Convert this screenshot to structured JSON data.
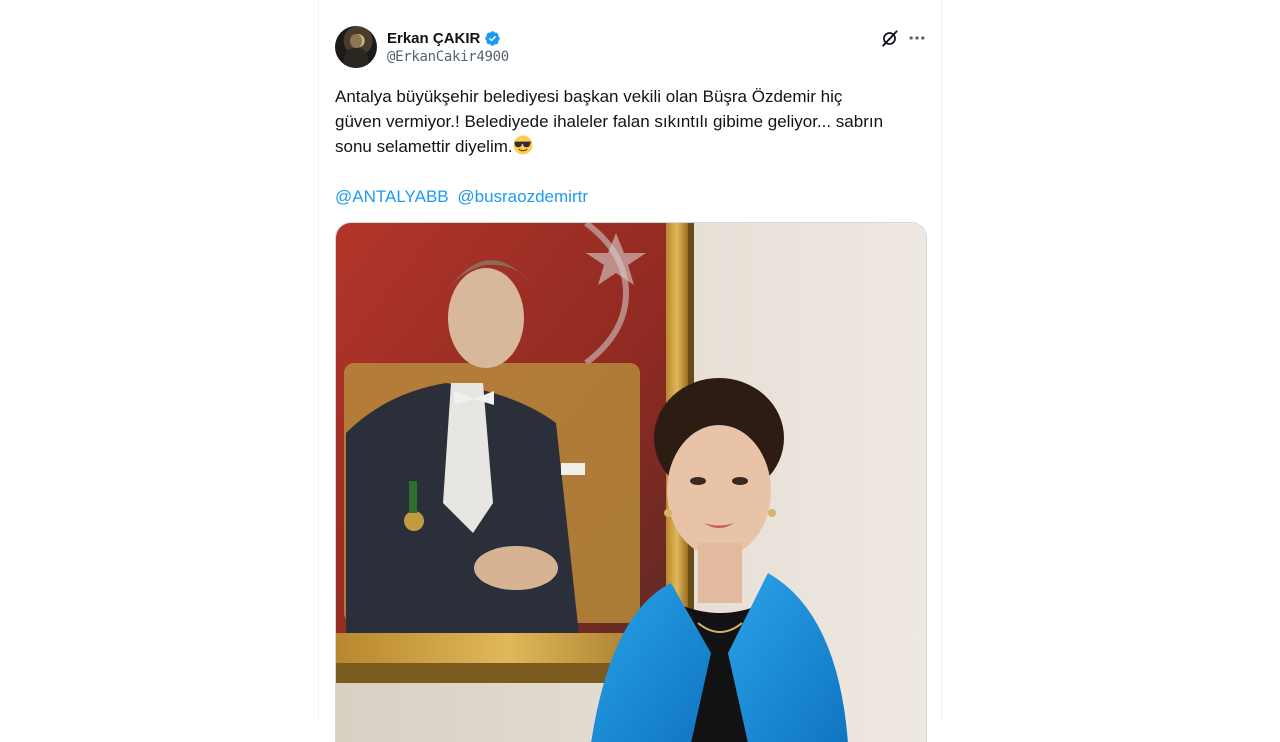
{
  "tweet": {
    "author": {
      "display_name": "Erkan ÇAKIR",
      "handle": "@ErkanCakir4900",
      "verified": true,
      "avatar": "avatar"
    },
    "text_lines": [
      "Antalya büyükşehir belediyesi başkan vekili olan Büşra Özdemir hiç",
      "güven vermiyor.!  Belediyede ihaleler falan sıkıntılı gibime geliyor... sabrın",
      "sonu selamettir diyelim."
    ],
    "emoji": "sunglasses-emoji",
    "mentions": [
      "@ANTALYABB",
      "@busraozdemirtr"
    ],
    "actions": {
      "grok_icon": "grok-icon",
      "more_icon": "more-options-icon"
    },
    "media": {
      "type": "photo"
    }
  },
  "colors": {
    "link": "#1d9bf0",
    "verified": "#1d9bf0",
    "text": "#0f1419",
    "secondary": "#536471",
    "jacket": "#1a8ed6"
  }
}
